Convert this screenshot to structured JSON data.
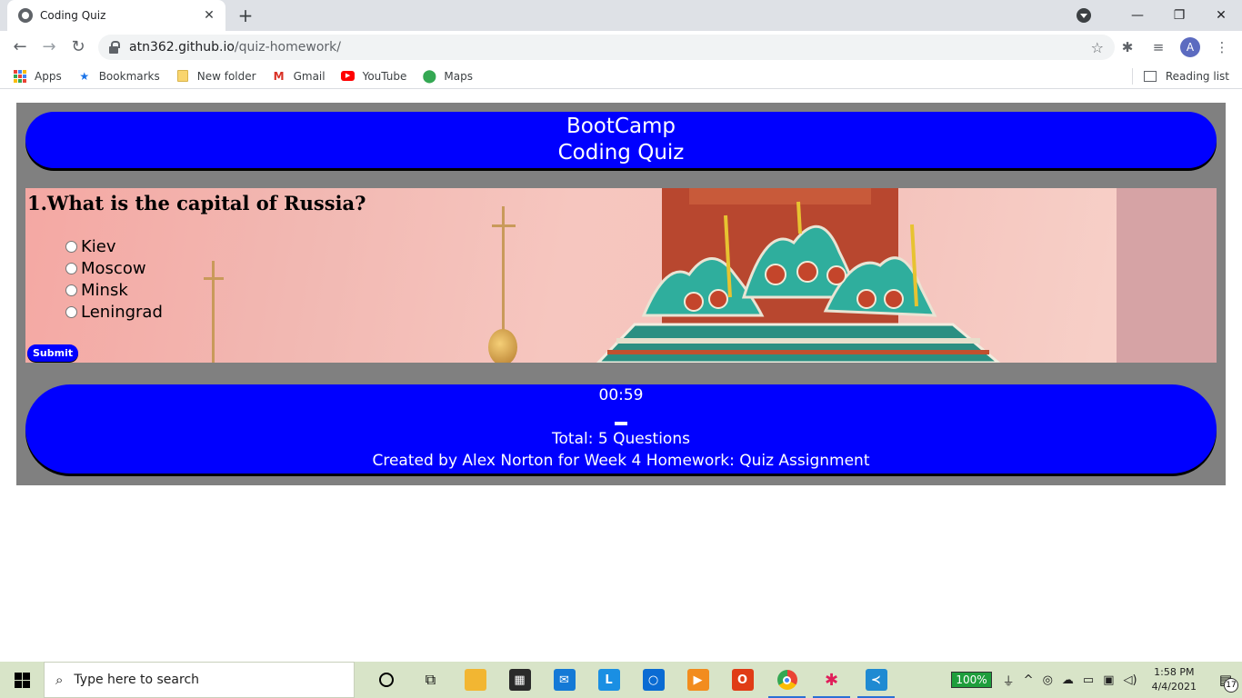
{
  "browser": {
    "tab_title": "Coding Quiz",
    "tab_close": "✕",
    "new_tab": "+",
    "url_host": "atn362.github.io",
    "url_path": "/quiz-homework/",
    "profile_initial": "A",
    "bookmarks": [
      {
        "label": "Apps",
        "icon": "apps-grid-icon"
      },
      {
        "label": "Bookmarks",
        "icon": "star-icon",
        "color": "#1a73e8"
      },
      {
        "label": "New folder",
        "icon": "folder-icon",
        "color": "#f9d56e"
      },
      {
        "label": "Gmail",
        "icon": "gmail-icon",
        "color": "#d93025"
      },
      {
        "label": "YouTube",
        "icon": "youtube-icon",
        "color": "#ff0000"
      },
      {
        "label": "Maps",
        "icon": "maps-pin-icon",
        "color": "#34a853"
      }
    ],
    "reading_list": "Reading list"
  },
  "page": {
    "header_line1": "BootCamp",
    "header_line2": "Coding Quiz",
    "question": "1.What is the capital of Russia?",
    "options": [
      "Kiev",
      "Moscow",
      "Minsk",
      "Leningrad"
    ],
    "submit_label": "Submit",
    "timer": "00:59",
    "total": "Total: 5 Questions",
    "credit": "Created by Alex Norton for Week 4 Homework: Quiz Assignment",
    "colors": {
      "pill": "#0000ff",
      "background": "#808080"
    }
  },
  "taskbar": {
    "search_placeholder": "Type here to search",
    "battery": "100%",
    "time": "1:58 PM",
    "date": "4/4/2021",
    "notifications": "17",
    "apps": [
      {
        "icon": "cortana-icon"
      },
      {
        "icon": "task-view-icon"
      },
      {
        "icon": "file-explorer-icon",
        "color": "#f2b632"
      },
      {
        "icon": "microsoft-store-icon",
        "color": "#2a2a2a"
      },
      {
        "icon": "mail-icon",
        "color": "#1479d6"
      },
      {
        "icon": "l-app-icon",
        "color": "#1a8fe3"
      },
      {
        "icon": "dell-icon",
        "color": "#0a6bd3"
      },
      {
        "icon": "media-app-icon",
        "color": "#f28c1e"
      },
      {
        "icon": "office-icon",
        "color": "#e03c16"
      },
      {
        "icon": "chrome-icon",
        "active": true
      },
      {
        "icon": "slack-icon",
        "active": true
      },
      {
        "icon": "vscode-icon",
        "color": "#1f8ad2",
        "active": true
      }
    ]
  }
}
